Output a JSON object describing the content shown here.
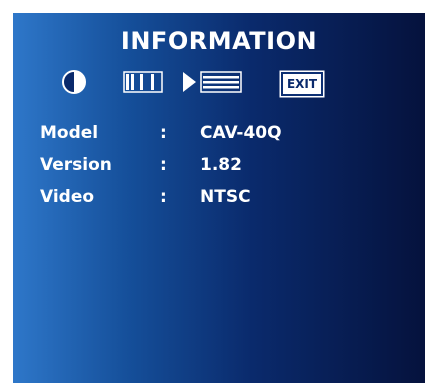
{
  "osd": {
    "title": "INFORMATION",
    "menu_icons": [
      {
        "name": "brightness-contrast-icon"
      },
      {
        "name": "color-bars-icon"
      },
      {
        "name": "information-icon",
        "selected": true
      },
      {
        "name": "exit-icon",
        "label": "EXIT"
      }
    ],
    "info": [
      {
        "key": "Model",
        "sep": ":",
        "value": "CAV-40Q"
      },
      {
        "key": "Version",
        "sep": ":",
        "value": "1.82"
      },
      {
        "key": "Video",
        "sep": ":",
        "value": "NTSC"
      }
    ]
  },
  "colors": {
    "panel_light": "#2e77c9",
    "panel_dark": "#05123d",
    "text": "#ffffff"
  }
}
